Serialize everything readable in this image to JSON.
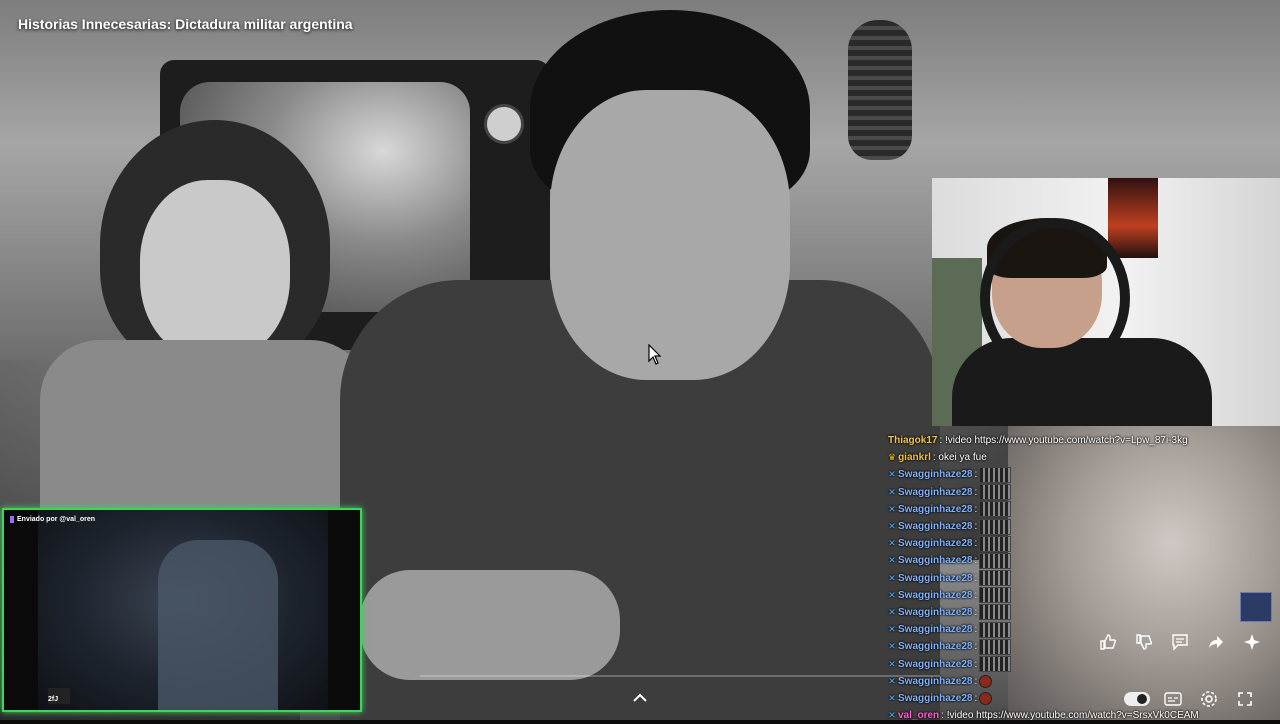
{
  "video": {
    "title": "Historias Innecesarias: Dictadura militar argentina"
  },
  "chat": {
    "messages": [
      {
        "user": "Thiagok17",
        "color": "#f5c542",
        "badge": "",
        "text": ": !video https://www.youtube.com/watch?v=Lpw_87i-3kg"
      },
      {
        "user": "giankrl",
        "color": "#f0c040",
        "badge": "crown",
        "text": ": okei ya fue"
      },
      {
        "user": "Swagginhaze28",
        "color": "#7fb2ff",
        "badge": "x",
        "text": ":"
      },
      {
        "user": "Swagginhaze28",
        "color": "#7fb2ff",
        "badge": "x",
        "text": ":"
      },
      {
        "user": "Swagginhaze28",
        "color": "#7fb2ff",
        "badge": "x",
        "text": ":"
      },
      {
        "user": "Swagginhaze28",
        "color": "#7fb2ff",
        "badge": "x",
        "text": ":"
      },
      {
        "user": "Swagginhaze28",
        "color": "#7fb2ff",
        "badge": "x",
        "text": ":"
      },
      {
        "user": "Swagginhaze28",
        "color": "#7fb2ff",
        "badge": "x",
        "text": ":"
      },
      {
        "user": "Swagginhaze28",
        "color": "#7fb2ff",
        "badge": "x",
        "text": ":"
      },
      {
        "user": "Swagginhaze28",
        "color": "#7fb2ff",
        "badge": "x",
        "text": ":"
      },
      {
        "user": "Swagginhaze28",
        "color": "#7fb2ff",
        "badge": "x",
        "text": ":"
      },
      {
        "user": "Swagginhaze28",
        "color": "#7fb2ff",
        "badge": "x",
        "text": ":"
      },
      {
        "user": "Swagginhaze28",
        "color": "#7fb2ff",
        "badge": "x",
        "text": ":"
      },
      {
        "user": "Swagginhaze28",
        "color": "#7fb2ff",
        "badge": "x",
        "text": ":"
      },
      {
        "user": "Swagginhaze28",
        "color": "#7fb2ff",
        "badge": "x",
        "text": ":"
      },
      {
        "user": "Swagginhaze28",
        "color": "#7fb2ff",
        "badge": "x",
        "text": ":"
      },
      {
        "user": "val_oren",
        "color": "#ff5fd2",
        "badge": "x",
        "text": ": !video https://www.youtube.com/watch?v=SrsxVk0CEAM"
      }
    ]
  },
  "clip": {
    "header": "Enviado por @val_oren",
    "logo_text": "2fJ"
  },
  "colors": {
    "clip_border": "#3fd45a",
    "chat_badge": "#52b3ff"
  },
  "icons": {
    "actions": [
      "thumbs-up-icon",
      "thumbs-down-icon",
      "comment-icon",
      "share-icon",
      "sparkle-icon"
    ],
    "controls": [
      "autoplay-toggle",
      "captions-icon",
      "settings-icon",
      "fullscreen-icon"
    ]
  }
}
